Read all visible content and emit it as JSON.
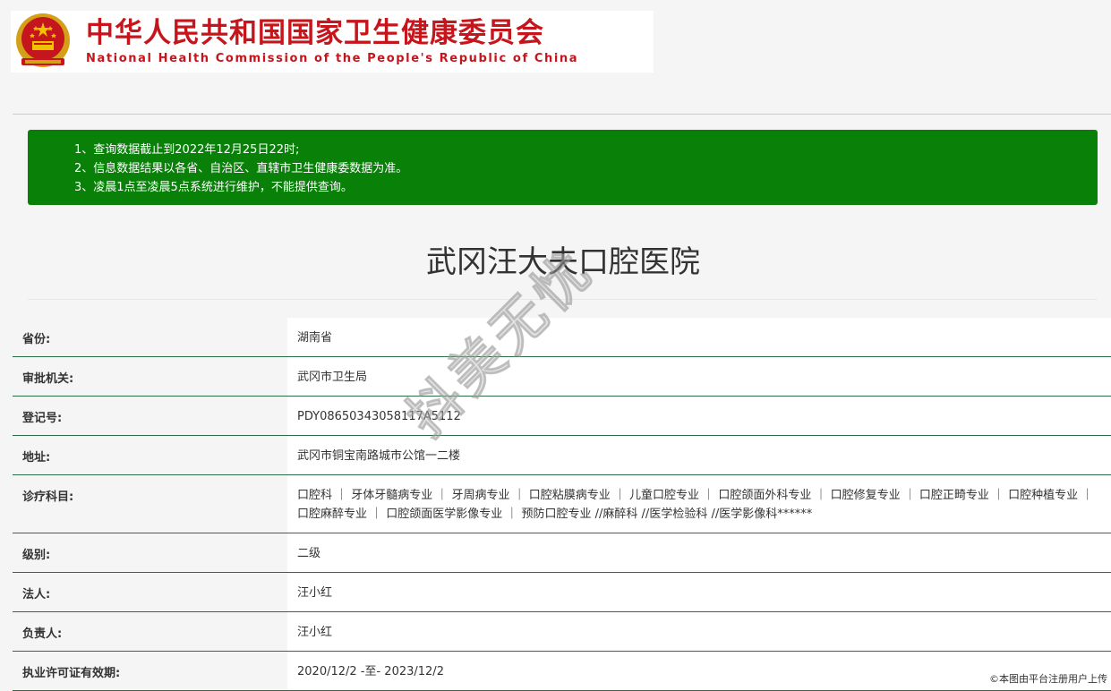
{
  "header": {
    "title_cn": "中华人民共和国国家卫生健康委员会",
    "title_en": "National Health Commission of the People's Republic of China",
    "emblem_icon": "national-emblem-icon",
    "brand_color": "#c4161c"
  },
  "notice": {
    "bg_color": "#098109",
    "lines": [
      "1、查询数据截止到2022年12月25日22时;",
      "2、信息数据结果以各省、自治区、直辖市卫生健康委数据为准。",
      "3、凌晨1点至凌晨5点系统进行维护，不能提供查询。"
    ]
  },
  "hospital_name": "武冈汪大夫口腔医院",
  "details": {
    "province_label": "省份:",
    "province_value": "湖南省",
    "authority_label": "审批机关:",
    "authority_value": "武冈市卫生局",
    "reg_label": "登记号:",
    "reg_value": "PDY08650343058117A5112",
    "address_label": "地址:",
    "address_value": "武冈市铜宝南路城市公馆一二楼",
    "departments_label": "诊疗科目:",
    "departments_value": "口腔科 ｜ 牙体牙髓病专业 ｜ 牙周病专业 ｜ 口腔粘膜病专业 ｜ 儿童口腔专业 ｜ 口腔颌面外科专业 ｜ 口腔修复专业 ｜ 口腔正畸专业 ｜ 口腔种植专业 ｜ 口腔麻醉专业 ｜ 口腔颌面医学影像专业 ｜ 预防口腔专业 //麻醉科 //医学检验科 //医学影像科******",
    "level_label": "级别:",
    "level_value": "二级",
    "legal_label": "法人:",
    "legal_value": "汪小红",
    "manager_label": "负责人:",
    "manager_value": "汪小红",
    "validity_label": "执业许可证有效期:",
    "validity_value": "2020/12/2 -至- 2023/12/2"
  },
  "watermark": "抖美无忧",
  "footer_note": "©本图由平台注册用户上传"
}
